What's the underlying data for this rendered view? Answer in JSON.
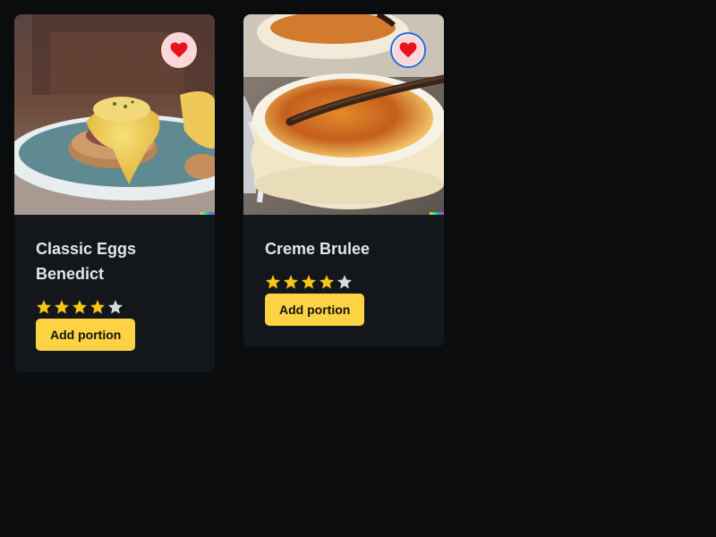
{
  "cards": [
    {
      "title": "Classic Eggs Benedict",
      "rating": 4,
      "rating_max": 5,
      "favorite_icon": "heart-icon",
      "add_label": "Add portion"
    },
    {
      "title": "Creme Brulee",
      "rating": 4,
      "rating_max": 5,
      "favorite_icon": "heart-icon",
      "add_label": "Add portion"
    }
  ],
  "colors": {
    "background": "#0b0c0e",
    "card": "#13161a",
    "accent": "#fdd343",
    "star_filled": "#f5c518",
    "star_empty": "#d6d9de",
    "heart": "#e8121b"
  }
}
